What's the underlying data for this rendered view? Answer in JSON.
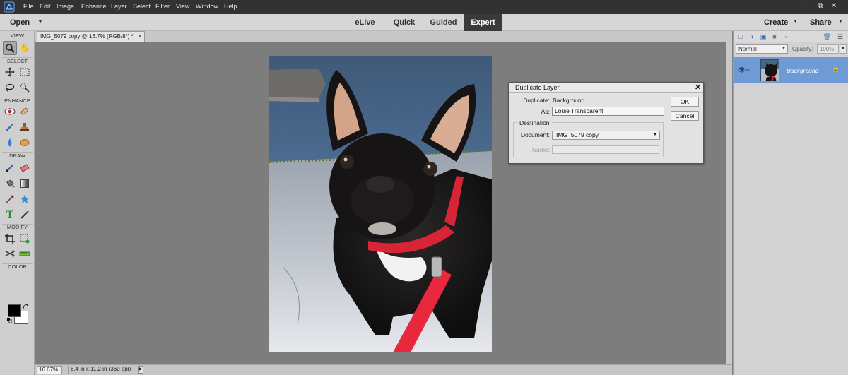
{
  "menubar": {
    "items": [
      "File",
      "Edit",
      "Image",
      "Enhance",
      "Layer",
      "Select",
      "Filter",
      "View",
      "Window",
      "Help"
    ],
    "window_controls": [
      "–",
      "⧉",
      "✕"
    ]
  },
  "modebar": {
    "open_label": "Open",
    "tabs": [
      "eLive",
      "Quick",
      "Guided",
      "Expert"
    ],
    "active_tab": "Expert",
    "create_label": "Create",
    "share_label": "Share"
  },
  "toolbox": {
    "sections": [
      "VIEW",
      "SELECT",
      "ENHANCE",
      "DRAW",
      "MODIFY",
      "COLOR"
    ],
    "foreground_color": "#000000",
    "background_color": "#ffffff"
  },
  "document": {
    "tab_title": "IMG_5079 copy @ 16.7% (RGB/8*) *",
    "zoom": "16.67%",
    "info": "8.4 in x 11.2 in (360 ppi)"
  },
  "layers": {
    "blend_mode": "Normal",
    "opacity_label": "Opacity:",
    "opacity_value": "100%",
    "layer_name": "Background"
  },
  "dialog": {
    "title": "Duplicate Layer",
    "duplicate_label": "Duplicate:",
    "duplicate_value": "Background",
    "as_label": "As:",
    "as_value": "Louie Transparent",
    "destination_label": "Destination",
    "document_label": "Document:",
    "document_value": "IMG_5079 copy",
    "name_label": "Name:",
    "ok_label": "OK",
    "cancel_label": "Cancel"
  },
  "colors": {
    "menubar_bg": "#323232",
    "active_tab_bg": "#3a3a3a",
    "layer_selected": "#6e9bd6",
    "leash_red": "#e8283c"
  }
}
